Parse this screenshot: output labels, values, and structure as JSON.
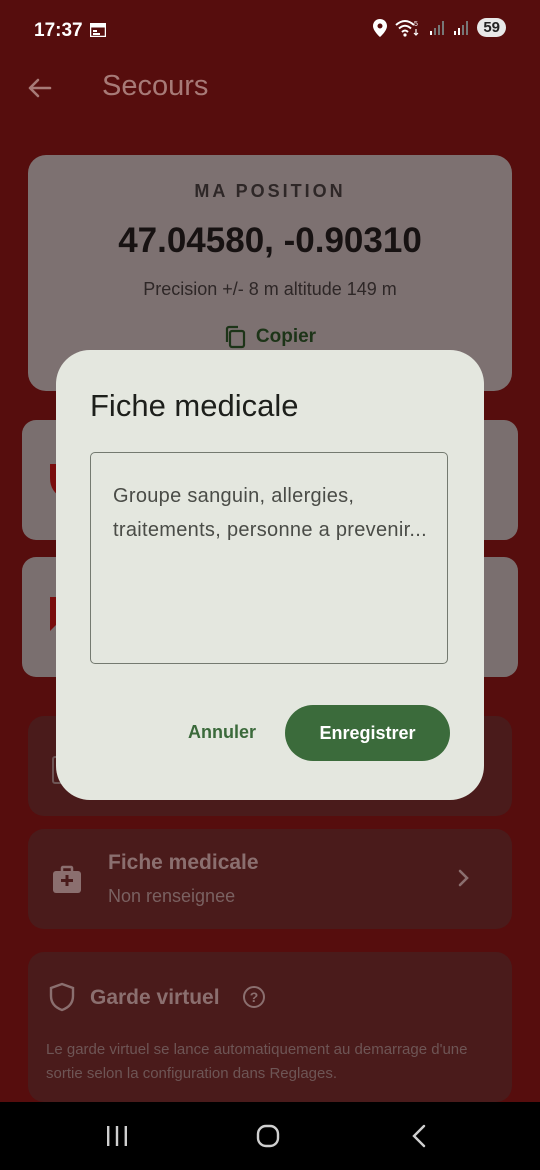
{
  "status": {
    "time": "17:37",
    "battery": "59"
  },
  "appbar": {
    "title": "Secours"
  },
  "position": {
    "label": "MA POSITION",
    "coords": "47.04580, -0.90310",
    "precision": "Precision +/- 8 m  altitude 149 m",
    "copy_label": "Copier"
  },
  "medical_card": {
    "title": "Fiche medicale",
    "subtitle": "Non renseignee"
  },
  "garde": {
    "title": "Garde virtuel",
    "description": "Le garde virtuel se lance automatiquement au demarrage d'une sortie selon la configuration dans Reglages."
  },
  "dialog": {
    "title": "Fiche medicale",
    "placeholder": "Groupe sanguin, allergies, traitements, personne a prevenir...",
    "cancel_label": "Annuler",
    "save_label": "Enregistrer"
  },
  "colors": {
    "primary": "#3b6b3b",
    "background": "#560d0d",
    "dialog": "#e4e7df"
  }
}
